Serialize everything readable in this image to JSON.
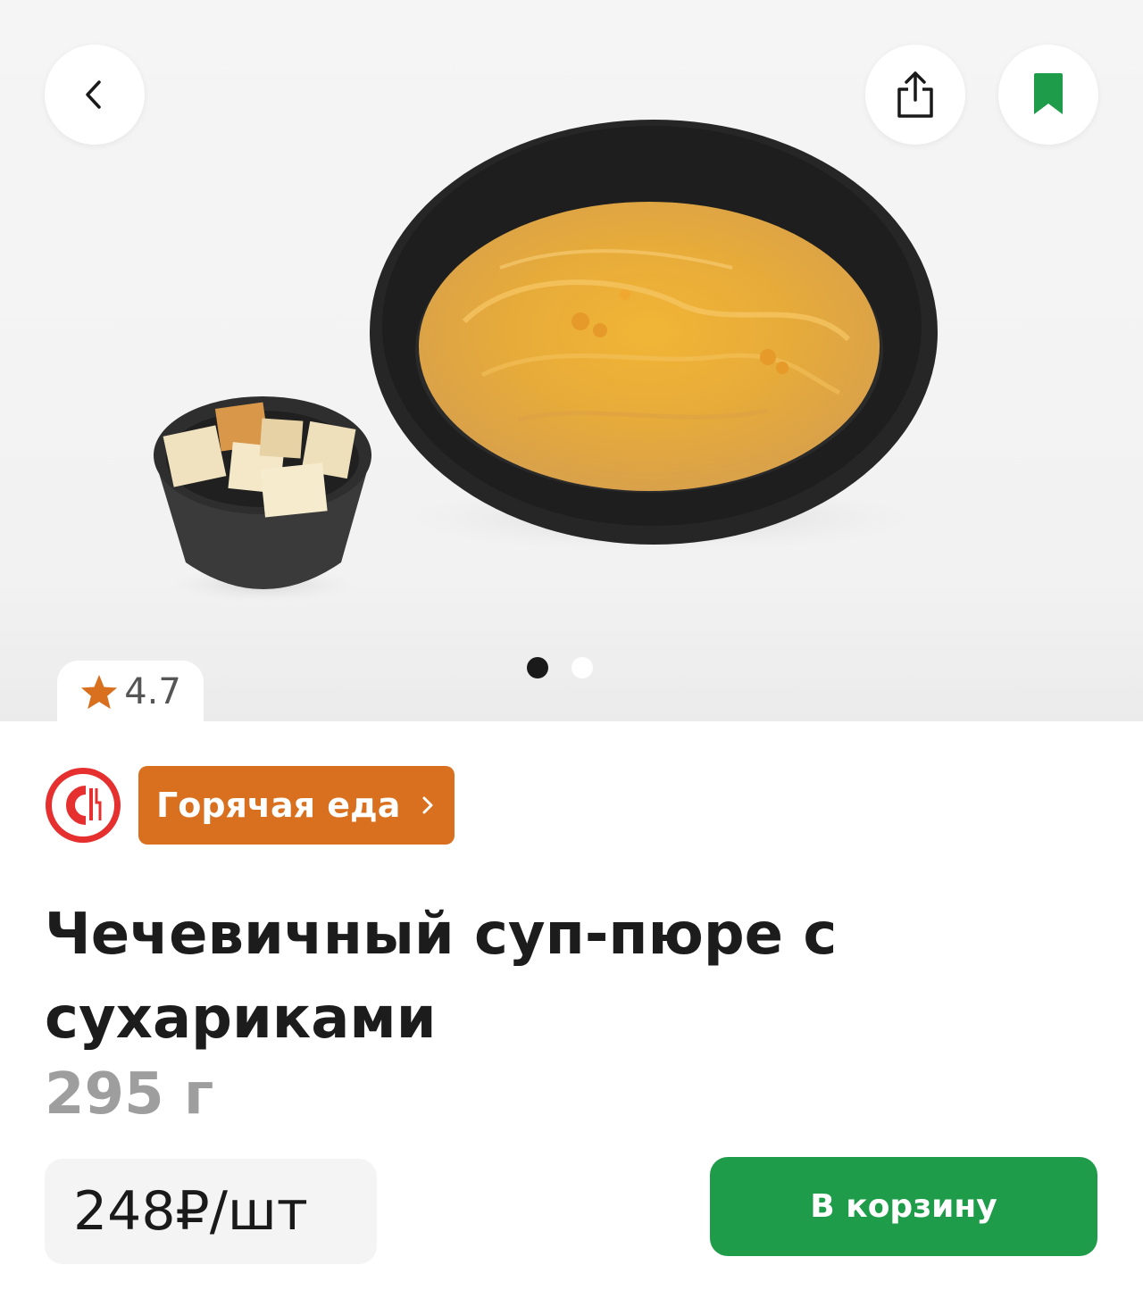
{
  "header": {
    "back_icon": "chevron-left-icon",
    "share_icon": "share-icon",
    "bookmark_icon": "bookmark-icon"
  },
  "gallery": {
    "total_images": 2,
    "active_index": 0
  },
  "rating": {
    "icon": "star-icon",
    "value": "4.7"
  },
  "store": {
    "logo_icon": "store-logo-icon",
    "category_label": "Горячая еда",
    "category_icon": "chevron-right-icon"
  },
  "product": {
    "title": "Чечевичный суп-пюре с сухариками",
    "weight": "295 г",
    "price": "248₽/шт"
  },
  "actions": {
    "add_to_cart_label": "В корзину"
  },
  "colors": {
    "accent_green": "#1f9c4a",
    "category_orange": "#d9701f",
    "rating_star": "#d9701f",
    "logo_red": "#e63030"
  }
}
